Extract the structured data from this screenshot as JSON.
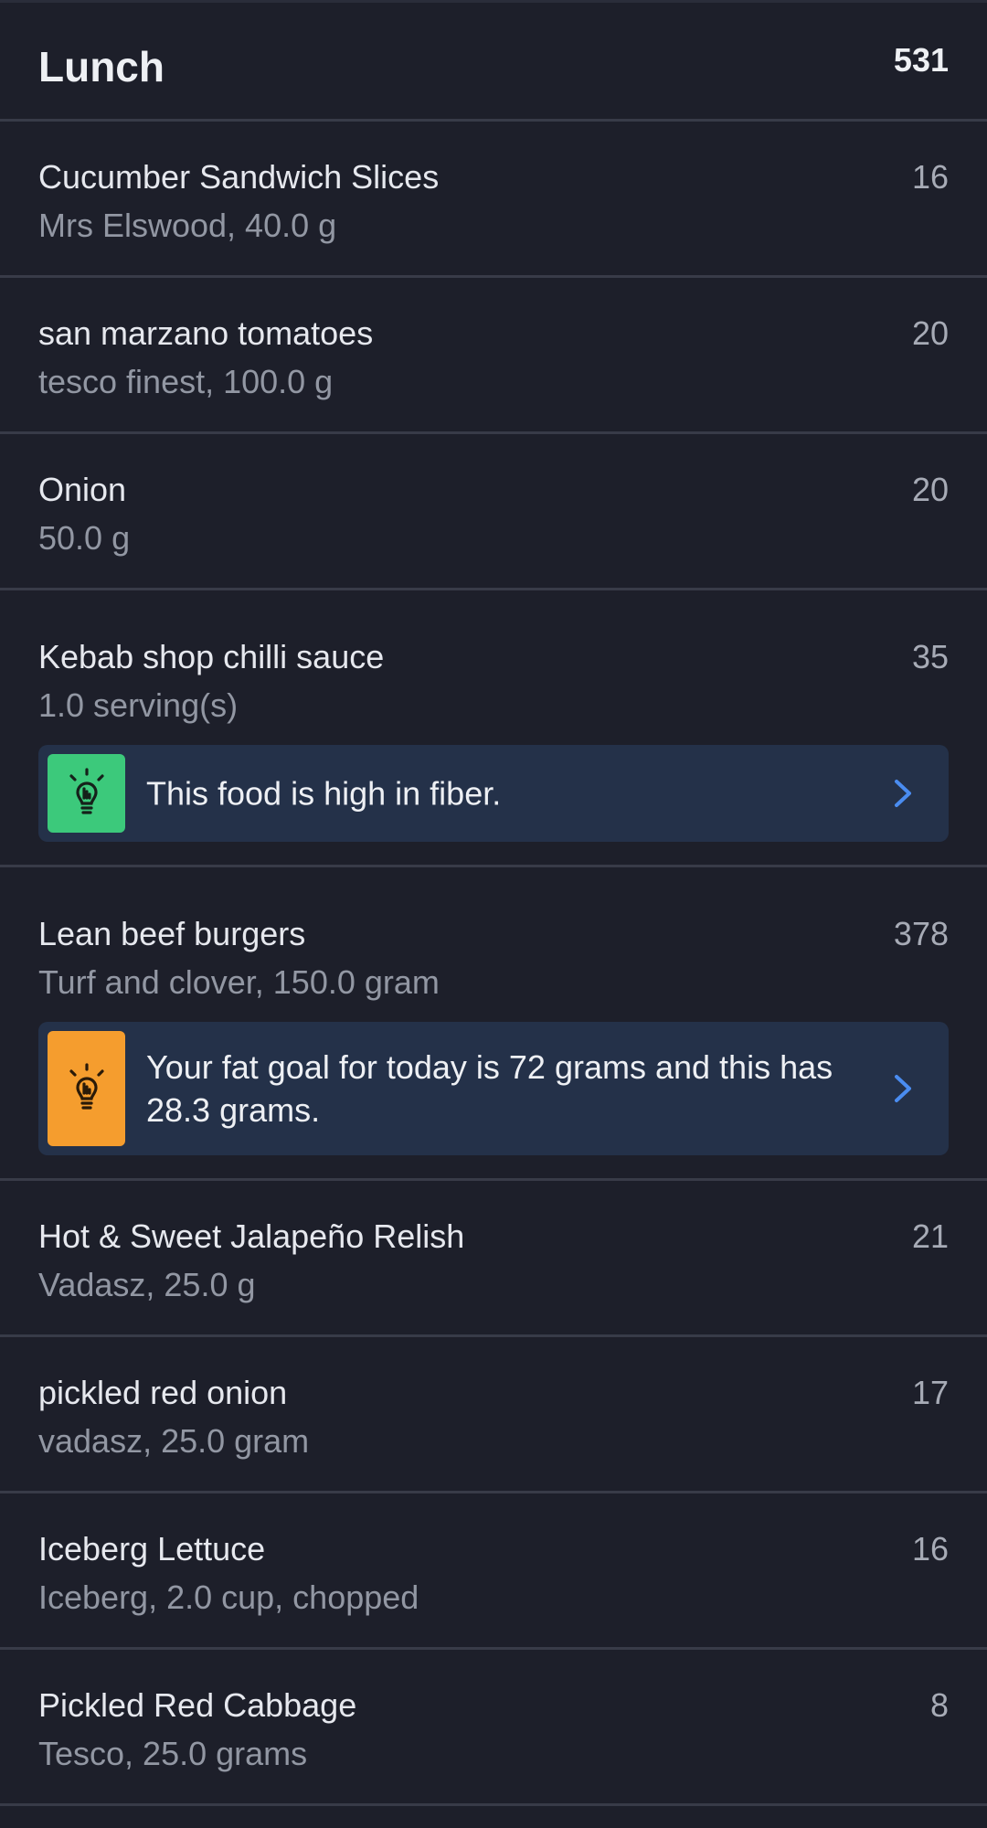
{
  "meal": {
    "title": "Lunch",
    "total": "531"
  },
  "items": [
    {
      "name": "Cucumber Sandwich Slices",
      "detail": "Mrs Elswood, 40.0 g",
      "calories": "16"
    },
    {
      "name": "san marzano tomatoes",
      "detail": "tesco finest, 100.0 g",
      "calories": "20"
    },
    {
      "name": "Onion",
      "detail": "50.0 g",
      "calories": "20"
    },
    {
      "name": "Kebab shop chilli sauce",
      "detail": "1.0 serving(s)",
      "calories": "35",
      "insight": {
        "text": "This food is high in fiber.",
        "icon": "lightbulb-icon",
        "color": "#3cc97b"
      }
    },
    {
      "name": "Lean beef burgers",
      "detail": "Turf and clover, 150.0 gram",
      "calories": "378",
      "insight": {
        "text": "Your fat goal for today is 72 grams and this has 28.3 grams.",
        "icon": "lightbulb-icon",
        "color": "#f59d2e"
      }
    },
    {
      "name": "Hot & Sweet Jalapeño Relish",
      "detail": "Vadasz, 25.0 g",
      "calories": "21"
    },
    {
      "name": "pickled red onion",
      "detail": "vadasz, 25.0 gram",
      "calories": "17"
    },
    {
      "name": "Iceberg Lettuce",
      "detail": "Iceberg, 2.0 cup, chopped",
      "calories": "16"
    },
    {
      "name": "Pickled Red Cabbage",
      "detail": "Tesco, 25.0 grams",
      "calories": "8"
    }
  ],
  "colors": {
    "background": "#1d1f2a",
    "divider": "#383b48",
    "insight_bg": "#243149",
    "chevron": "#4a8cf0"
  }
}
